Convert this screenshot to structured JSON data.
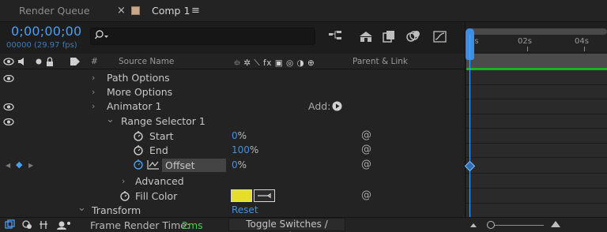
{
  "tabs": {
    "render_queue": "Render Queue",
    "close": "×",
    "comp": "Comp 1",
    "menu": "≡"
  },
  "header": {
    "timecode": "0;00;00;00",
    "frames": "00000 (29.97 fps)",
    "search_icon_glyph": "⌕"
  },
  "columns": {
    "number": "#",
    "source_name": "Source Name",
    "switch_icons": "⯐ ✲ ⟍ fx ▣ ◎ ◑ ⊕",
    "parent_link": "Parent & Link"
  },
  "rows": {
    "path_options": "Path Options",
    "more_options": "More Options",
    "animator": "Animator 1",
    "add_label": "Add:",
    "range_selector": "Range Selector 1",
    "start": "Start",
    "start_value": "0",
    "start_unit": "%",
    "end": "End",
    "end_value": "100",
    "end_unit": "%",
    "offset": "Offset",
    "offset_value": "0",
    "offset_unit": "%",
    "advanced": "Advanced",
    "fill_color": "Fill Color",
    "transform": "Transform",
    "transform_reset": "Reset"
  },
  "glyphs": {
    "chev_right": "›",
    "chev_down": "⌄",
    "spiral": "@",
    "diamond": "◆",
    "prev_key": "◀",
    "next_key": "▶"
  },
  "timeline": {
    "ticks": [
      "0s",
      "02s",
      "04s"
    ]
  },
  "footer": {
    "render_label": "Frame Render Time:",
    "render_value": "2ms",
    "toggle": "Toggle Switches / Modes"
  },
  "colors": {
    "accent": "#4d9ef0",
    "fill_color": "#e5df2a",
    "green": "#3fd24b"
  }
}
